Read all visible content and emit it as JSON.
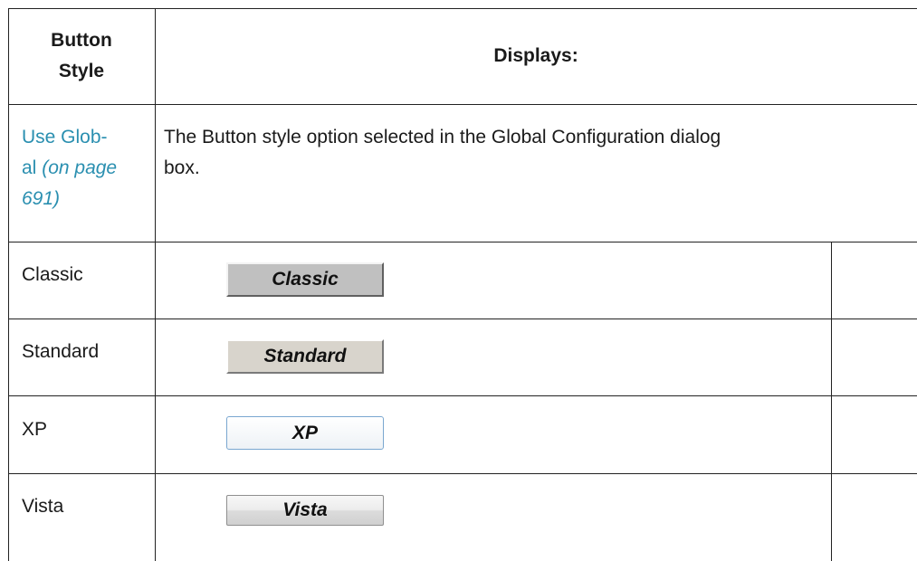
{
  "table": {
    "headers": {
      "col1_line1": "Button",
      "col1_line2": "Style",
      "col2": "Displays:"
    },
    "global_row": {
      "link_line1": "Use Glob-",
      "link_line2": "al",
      "page_ref_a": "(on page",
      "page_ref_b": "691)",
      "description_line1": "The Button style option selected in the Global Configuration dialog",
      "description_line2": "box."
    },
    "rows": [
      {
        "style": "Classic",
        "button_label": "Classic"
      },
      {
        "style": "Standard",
        "button_label": "Standard"
      },
      {
        "style": "XP",
        "button_label": "XP"
      },
      {
        "style": "Vista",
        "button_label": "Vista"
      }
    ]
  },
  "colors": {
    "link": "#2a8fb0",
    "grid": "#222222"
  }
}
